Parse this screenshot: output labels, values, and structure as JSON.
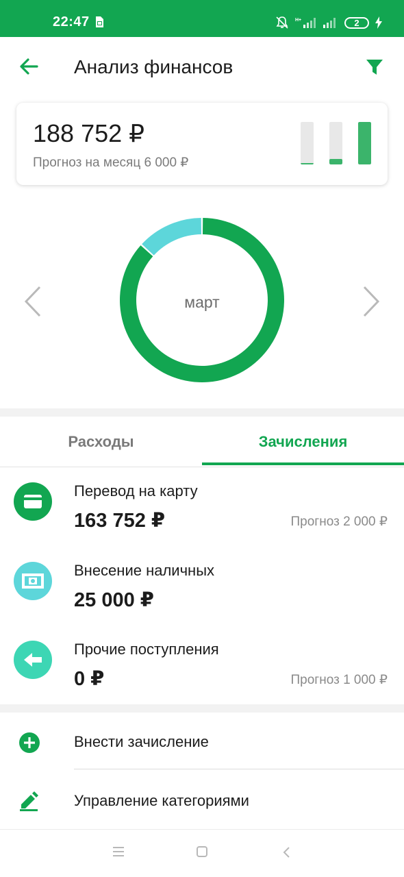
{
  "status_bar": {
    "time": "22:47",
    "battery": "2"
  },
  "header": {
    "title": "Анализ финансов"
  },
  "summary": {
    "amount": "188 752 ₽",
    "forecast": "Прогноз на месяц 6 000 ₽",
    "bars": [
      {
        "fill_fraction": 0.03
      },
      {
        "fill_fraction": 0.13
      },
      {
        "fill_fraction": 1.0
      }
    ]
  },
  "chart": {
    "month": "март",
    "segments": [
      {
        "category": "Перевод на карту",
        "value": 163752,
        "color": "#12a651"
      },
      {
        "category": "Внесение наличных",
        "value": 25000,
        "color": "#5dd6da"
      }
    ]
  },
  "tabs": [
    {
      "label": "Расходы",
      "active": false
    },
    {
      "label": "Зачисления",
      "active": true
    }
  ],
  "categories": [
    {
      "name": "Перевод на карту",
      "amount": "163 752 ₽",
      "forecast": "Прогноз 2 000 ₽",
      "icon": "card-icon",
      "color": "#12a651"
    },
    {
      "name": "Внесение наличных",
      "amount": "25 000 ₽",
      "forecast": "",
      "icon": "cash-icon",
      "color": "#5dd6da"
    },
    {
      "name": "Прочие поступления",
      "amount": "0 ₽",
      "forecast": "Прогноз 1 000 ₽",
      "icon": "arrow-left-icon",
      "color": "#3dd6b4"
    }
  ],
  "actions": [
    {
      "label": "Внести зачисление",
      "icon": "plus-circle-icon"
    },
    {
      "label": "Управление категориями",
      "icon": "pencil-icon"
    }
  ],
  "colors": {
    "brand": "#12a651",
    "cyan": "#5dd6da",
    "teal": "#3dd6b4"
  }
}
